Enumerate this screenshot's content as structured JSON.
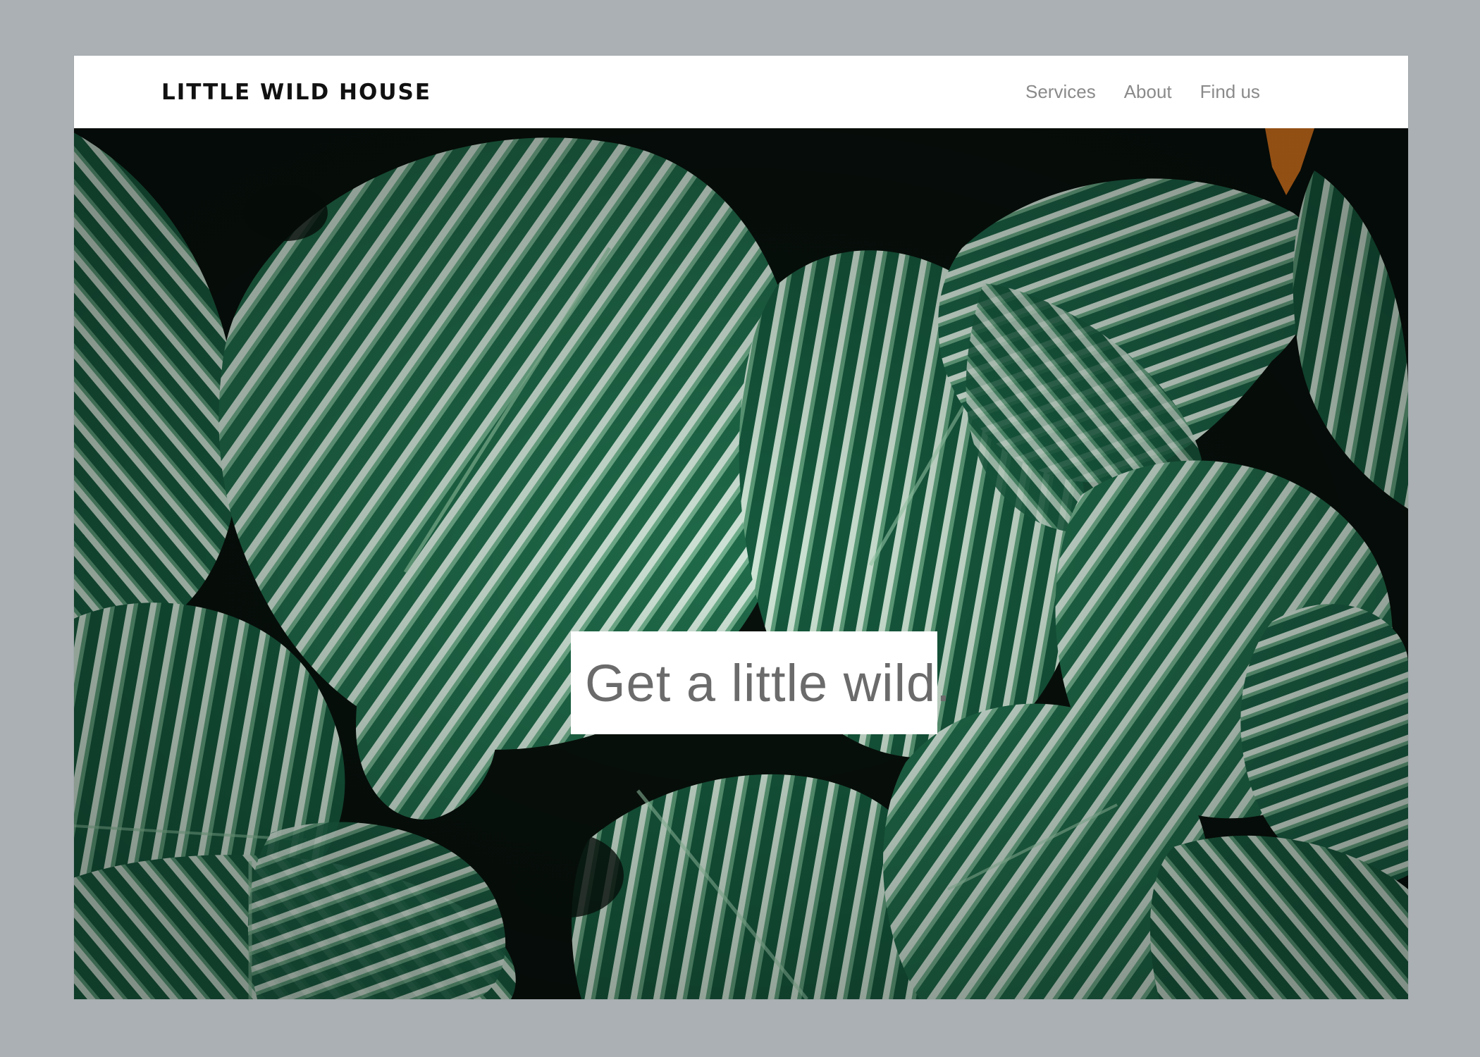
{
  "site": {
    "brand": "LITTLE WILD HOUSE"
  },
  "nav": {
    "items": [
      {
        "label": "Services"
      },
      {
        "label": "About"
      },
      {
        "label": "Find us"
      }
    ]
  },
  "hero": {
    "image_subject": "tropical-leaves-photo",
    "tagline": "Get a little wild."
  },
  "colors": {
    "page_background": "#aab0b3",
    "header_background": "#ffffff",
    "brand_text": "#111111",
    "nav_text": "#8a8a8a",
    "leaf_dark": "#0f4a34",
    "leaf_mid": "#2f7a57",
    "leaf_light": "#d9eadf"
  }
}
